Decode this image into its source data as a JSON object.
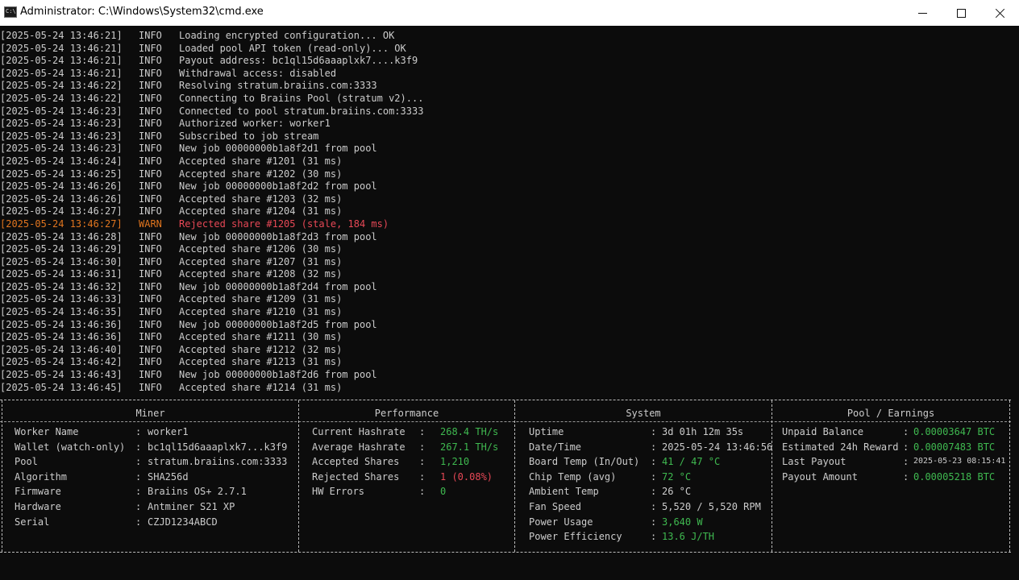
{
  "window": {
    "title": "Administrator: C:\\Windows\\System32\\cmd.exe"
  },
  "log": [
    {
      "ts": "[2025-05-24 13:46:21]",
      "level": "INFO",
      "msg": "Loading encrypted configuration... OK",
      "kind": "info"
    },
    {
      "ts": "[2025-05-24 13:46:21]",
      "level": "INFO",
      "msg": "Loaded pool API token (read-only)... OK",
      "kind": "info"
    },
    {
      "ts": "[2025-05-24 13:46:21]",
      "level": "INFO",
      "msg": "Payout address: bc1ql15d6aaaplxk7....k3f9",
      "kind": "info"
    },
    {
      "ts": "[2025-05-24 13:46:21]",
      "level": "INFO",
      "msg": "Withdrawal access: disabled",
      "kind": "info"
    },
    {
      "ts": "[2025-05-24 13:46:22]",
      "level": "INFO",
      "msg": "Resolving stratum.braiins.com:3333",
      "kind": "info"
    },
    {
      "ts": "[2025-05-24 13:46:22]",
      "level": "INFO",
      "msg": "Connecting to Braiins Pool (stratum v2)...",
      "kind": "info"
    },
    {
      "ts": "[2025-05-24 13:46:23]",
      "level": "INFO",
      "msg": "Connected to pool stratum.braiins.com:3333",
      "kind": "info"
    },
    {
      "ts": "[2025-05-24 13:46:23]",
      "level": "INFO",
      "msg": "Authorized worker: worker1",
      "kind": "info"
    },
    {
      "ts": "[2025-05-24 13:46:23]",
      "level": "INFO",
      "msg": "Subscribed to job stream",
      "kind": "info"
    },
    {
      "ts": "[2025-05-24 13:46:23]",
      "level": "INFO",
      "msg": "New job 00000000b1a8f2d1 from pool",
      "kind": "info"
    },
    {
      "ts": "[2025-05-24 13:46:24]",
      "level": "INFO",
      "msg": "Accepted share #1201 (31 ms)",
      "kind": "info"
    },
    {
      "ts": "[2025-05-24 13:46:25]",
      "level": "INFO",
      "msg": "Accepted share #1202 (30 ms)",
      "kind": "info"
    },
    {
      "ts": "[2025-05-24 13:46:26]",
      "level": "INFO",
      "msg": "New job 00000000b1a8f2d2 from pool",
      "kind": "info"
    },
    {
      "ts": "[2025-05-24 13:46:26]",
      "level": "INFO",
      "msg": "Accepted share #1203 (32 ms)",
      "kind": "info"
    },
    {
      "ts": "[2025-05-24 13:46:27]",
      "level": "INFO",
      "msg": "Accepted share #1204 (31 ms)",
      "kind": "info"
    },
    {
      "ts": "[2025-05-24 13:46:27]",
      "level": "WARN",
      "msg": "Rejected share #1205 (stale, 184 ms)",
      "kind": "warn"
    },
    {
      "ts": "[2025-05-24 13:46:28]",
      "level": "INFO",
      "msg": "New job 00000000b1a8f2d3 from pool",
      "kind": "info"
    },
    {
      "ts": "[2025-05-24 13:46:29]",
      "level": "INFO",
      "msg": "Accepted share #1206 (30 ms)",
      "kind": "info"
    },
    {
      "ts": "[2025-05-24 13:46:30]",
      "level": "INFO",
      "msg": "Accepted share #1207 (31 ms)",
      "kind": "info"
    },
    {
      "ts": "[2025-05-24 13:46:31]",
      "level": "INFO",
      "msg": "Accepted share #1208 (32 ms)",
      "kind": "info"
    },
    {
      "ts": "[2025-05-24 13:46:32]",
      "level": "INFO",
      "msg": "New job 00000000b1a8f2d4 from pool",
      "kind": "info"
    },
    {
      "ts": "[2025-05-24 13:46:33]",
      "level": "INFO",
      "msg": "Accepted share #1209 (31 ms)",
      "kind": "info"
    },
    {
      "ts": "[2025-05-24 13:46:35]",
      "level": "INFO",
      "msg": "Accepted share #1210 (31 ms)",
      "kind": "info"
    },
    {
      "ts": "[2025-05-24 13:46:36]",
      "level": "INFO",
      "msg": "New job 00000000b1a8f2d5 from pool",
      "kind": "info"
    },
    {
      "ts": "[2025-05-24 13:46:36]",
      "level": "INFO",
      "msg": "Accepted share #1211 (30 ms)",
      "kind": "info"
    },
    {
      "ts": "[2025-05-24 13:46:40]",
      "level": "INFO",
      "msg": "Accepted share #1212 (32 ms)",
      "kind": "info"
    },
    {
      "ts": "[2025-05-24 13:46:42]",
      "level": "INFO",
      "msg": "Accepted share #1213 (31 ms)",
      "kind": "info"
    },
    {
      "ts": "[2025-05-24 13:46:43]",
      "level": "INFO",
      "msg": "New job 00000000b1a8f2d6 from pool",
      "kind": "info"
    },
    {
      "ts": "[2025-05-24 13:46:45]",
      "level": "INFO",
      "msg": "Accepted share #1214 (31 ms)",
      "kind": "info"
    }
  ],
  "panels": {
    "miner": {
      "title": "Miner",
      "rows": [
        {
          "label": "Worker Name",
          "value": "worker1"
        },
        {
          "label": "Wallet (watch-only)",
          "value": "bc1ql15d6aaaplxk7...k3f9"
        },
        {
          "label": "Pool",
          "value": "stratum.braiins.com:3333"
        },
        {
          "label": "Algorithm",
          "value": "SHA256d"
        },
        {
          "label": "Firmware",
          "value": "Braiins OS+ 2.7.1"
        },
        {
          "label": "Hardware",
          "value": "Antminer S21 XP"
        },
        {
          "label": "Serial",
          "value": "CZJD1234ABCD"
        }
      ]
    },
    "performance": {
      "title": "Performance",
      "rows": [
        {
          "label": "Current Hashrate",
          "value": "268.4 TH/s",
          "color": "green"
        },
        {
          "label": "Average Hashrate",
          "value": "267.1 TH/s",
          "color": "green"
        },
        {
          "label": "Accepted Shares",
          "value": "1,210",
          "color": "green"
        },
        {
          "label": "Rejected Shares",
          "value": "1 (0.08%)",
          "color": "red"
        },
        {
          "label": "HW Errors",
          "value": "0",
          "color": "green"
        }
      ]
    },
    "system": {
      "title": "System",
      "rows": [
        {
          "label": "Uptime",
          "value": "3d 01h 12m 35s",
          "color": ""
        },
        {
          "label": "Date/Time",
          "value": "2025-05-24 13:46:56",
          "color": ""
        },
        {
          "label": "Board Temp (In/Out)",
          "value": "41 / 47 °C",
          "color": "green"
        },
        {
          "label": "Chip Temp (avg)",
          "value": "72 °C",
          "color": "green"
        },
        {
          "label": "Ambient Temp",
          "value": "26 °C",
          "color": ""
        },
        {
          "label": "Fan Speed",
          "value": "5,520 / 5,520 RPM",
          "color": ""
        },
        {
          "label": "Power Usage",
          "value": "3,640 W",
          "color": "green"
        },
        {
          "label": "Power Efficiency",
          "value": "13.6 J/TH",
          "color": "green"
        }
      ]
    },
    "pool": {
      "title": "Pool / Earnings",
      "rows": [
        {
          "label": "Unpaid Balance",
          "value": "0.00003647 BTC",
          "color": "green"
        },
        {
          "label": "Estimated 24h Reward",
          "value": "0.00007483 BTC",
          "color": "green"
        },
        {
          "label": "Last Payout",
          "value": "2025-05-23 08:15:41",
          "color": "small"
        },
        {
          "label": "Payout Amount",
          "value": "0.00005218 BTC",
          "color": "green"
        }
      ]
    }
  }
}
